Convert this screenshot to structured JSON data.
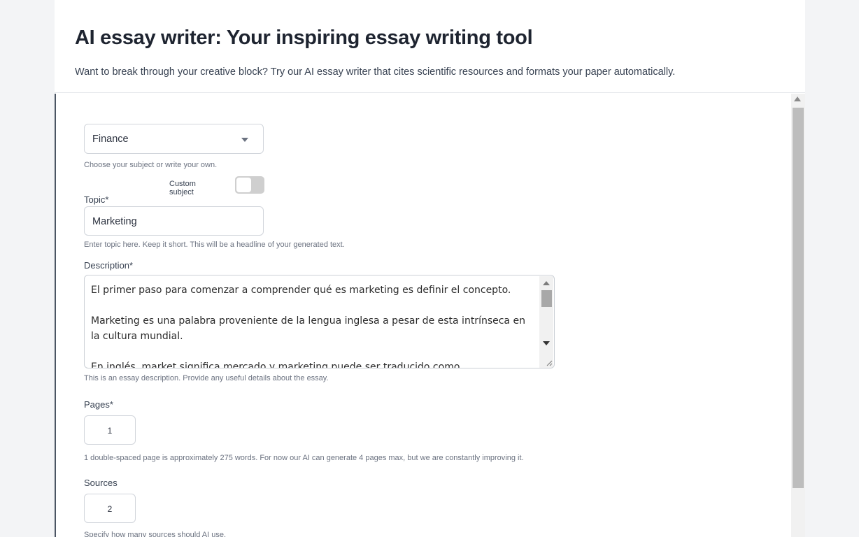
{
  "header": {
    "title": "AI essay writer: Your inspiring essay writing tool",
    "subtitle": "Want to break through your creative block? Try our AI essay writer that cites scientific resources and formats your paper automatically."
  },
  "form": {
    "subject": {
      "value": "Finance",
      "hint": "Choose your subject or write your own.",
      "custom_label": "Custom subject",
      "custom_enabled": false
    },
    "topic": {
      "label": "Topic*",
      "value": "Marketing",
      "hint": "Enter topic here. Keep it short. This will be a headline of your generated text."
    },
    "description": {
      "label": "Description*",
      "paragraphs": [
        "El primer paso para comenzar a comprender qué es marketing es definir el concepto.",
        "Marketing es una palabra proveniente de la lengua inglesa a pesar de esta intrínseca en la cultura mundial.",
        "En inglés, market significa mercado y marketing puede ser traducido como mercadotecnia o"
      ],
      "hint": "This is an essay description. Provide any useful details about the essay."
    },
    "pages": {
      "label": "Pages*",
      "value": "1",
      "hint": "1 double-spaced page is approximately 275 words. For now our AI can generate 4 pages max, but we are constantly improving it."
    },
    "sources": {
      "label": "Sources",
      "value": "2",
      "hint": "Specify how many sources should AI use."
    }
  },
  "icons": {
    "subject_caret": "chevron-down-icon",
    "scroll_up": "arrow-up-icon",
    "scroll_down": "arrow-down-icon",
    "resize": "resize-handle-icon"
  },
  "colors": {
    "title": "#1e2430",
    "frame_border": "#4b5563",
    "toggle_off": "#cfcfcf",
    "input_border": "#d1d5db"
  }
}
